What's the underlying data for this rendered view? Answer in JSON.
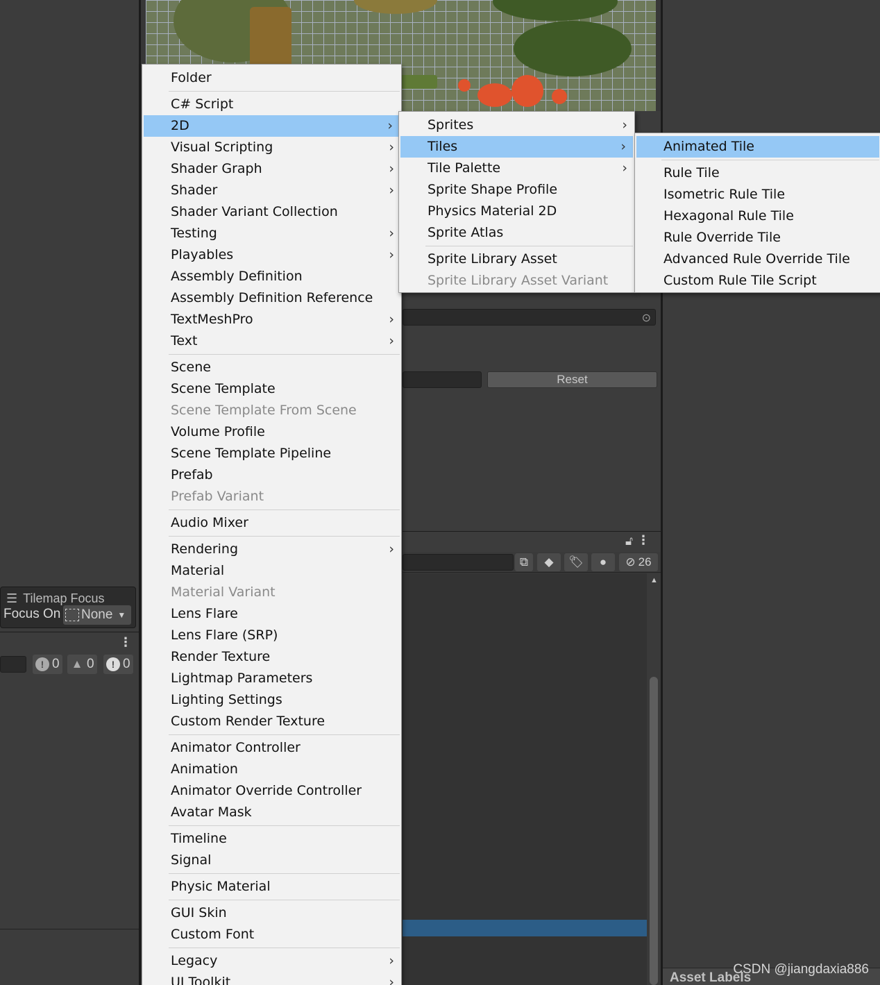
{
  "tilemap_focus": {
    "title": "Tilemap Focus",
    "focus_label": "Focus On",
    "focus_value": "None"
  },
  "console": {
    "info_count": "0",
    "warn_count": "0",
    "error_count": "0"
  },
  "inspector": {
    "reset_label": "Reset"
  },
  "project": {
    "hidden_count": "26"
  },
  "asset_labels": "Asset Labels",
  "watermark": "CSDN @jiangdaxia886",
  "colors": {
    "menu_bg": "#f2f2f2",
    "menu_highlight": "#95c8f5",
    "editor_bg": "#383838",
    "selection_blue": "#2c5d87"
  },
  "menu_main": [
    {
      "label": "Folder"
    },
    {
      "sep": true
    },
    {
      "label": "C# Script"
    },
    {
      "label": "2D",
      "submenu": true,
      "highlighted": true
    },
    {
      "label": "Visual Scripting",
      "submenu": true
    },
    {
      "label": "Shader Graph",
      "submenu": true
    },
    {
      "label": "Shader",
      "submenu": true
    },
    {
      "label": "Shader Variant Collection"
    },
    {
      "label": "Testing",
      "submenu": true
    },
    {
      "label": "Playables",
      "submenu": true
    },
    {
      "label": "Assembly Definition"
    },
    {
      "label": "Assembly Definition Reference"
    },
    {
      "label": "TextMeshPro",
      "submenu": true
    },
    {
      "label": "Text",
      "submenu": true
    },
    {
      "sep": true
    },
    {
      "label": "Scene"
    },
    {
      "label": "Scene Template"
    },
    {
      "label": "Scene Template From Scene",
      "disabled": true
    },
    {
      "label": "Volume Profile"
    },
    {
      "label": "Scene Template Pipeline"
    },
    {
      "label": "Prefab"
    },
    {
      "label": "Prefab Variant",
      "disabled": true
    },
    {
      "sep": true
    },
    {
      "label": "Audio Mixer"
    },
    {
      "sep": true
    },
    {
      "label": "Rendering",
      "submenu": true
    },
    {
      "label": "Material"
    },
    {
      "label": "Material Variant",
      "disabled": true
    },
    {
      "label": "Lens Flare"
    },
    {
      "label": "Lens Flare (SRP)"
    },
    {
      "label": "Render Texture"
    },
    {
      "label": "Lightmap Parameters"
    },
    {
      "label": "Lighting Settings"
    },
    {
      "label": "Custom Render Texture"
    },
    {
      "sep": true
    },
    {
      "label": "Animator Controller"
    },
    {
      "label": "Animation"
    },
    {
      "label": "Animator Override Controller"
    },
    {
      "label": "Avatar Mask"
    },
    {
      "sep": true
    },
    {
      "label": "Timeline"
    },
    {
      "label": "Signal"
    },
    {
      "sep": true
    },
    {
      "label": "Physic Material"
    },
    {
      "sep": true
    },
    {
      "label": "GUI Skin"
    },
    {
      "label": "Custom Font"
    },
    {
      "sep": true
    },
    {
      "label": "Legacy",
      "submenu": true
    },
    {
      "label": "UI Toolkit",
      "submenu": true
    }
  ],
  "menu_2d": [
    {
      "label": "Sprites",
      "submenu": true
    },
    {
      "label": "Tiles",
      "submenu": true,
      "highlighted": true
    },
    {
      "label": "Tile Palette",
      "submenu": true
    },
    {
      "label": "Sprite Shape Profile"
    },
    {
      "label": "Physics Material 2D"
    },
    {
      "label": "Sprite Atlas"
    },
    {
      "sep": true
    },
    {
      "label": "Sprite Library Asset"
    },
    {
      "label": "Sprite Library Asset Variant",
      "disabled": true
    }
  ],
  "menu_tiles": [
    {
      "label": "Animated Tile",
      "highlighted": true
    },
    {
      "sep": true
    },
    {
      "label": "Rule Tile"
    },
    {
      "label": "Isometric Rule Tile"
    },
    {
      "label": "Hexagonal Rule Tile"
    },
    {
      "label": "Rule Override Tile"
    },
    {
      "label": "Advanced Rule Override Tile"
    },
    {
      "label": "Custom Rule Tile Script"
    }
  ]
}
